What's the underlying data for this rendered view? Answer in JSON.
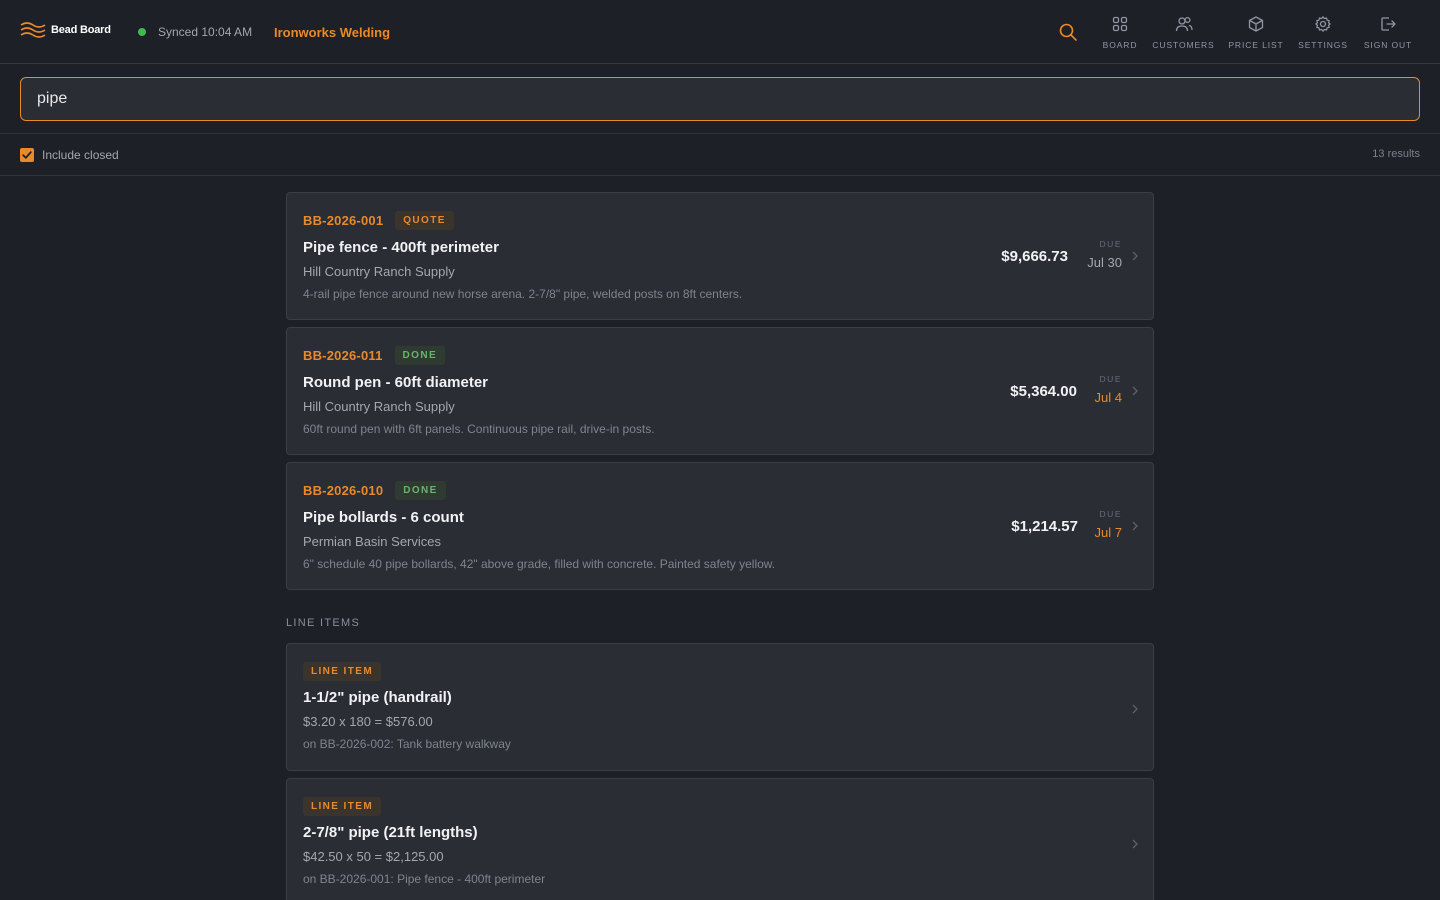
{
  "header": {
    "brand": "Bead Board",
    "sync_status": "Synced 10:04 AM",
    "company": "Ironworks Welding",
    "nav": [
      {
        "label": "BOARD",
        "icon": "grid-icon"
      },
      {
        "label": "CUSTOMERS",
        "icon": "users-icon"
      },
      {
        "label": "PRICE LIST",
        "icon": "box-icon"
      },
      {
        "label": "SETTINGS",
        "icon": "gear-icon"
      },
      {
        "label": "SIGN OUT",
        "icon": "sign-out-icon"
      }
    ],
    "accent_color": "#e8892b",
    "sync_color": "#3fb950"
  },
  "search": {
    "value": "pipe"
  },
  "filters": {
    "include_closed_label": "Include closed",
    "include_closed_checked": true,
    "result_count": "13 results"
  },
  "jobs": [
    {
      "id": "BB-2026-001",
      "status": "QUOTE",
      "title": "Pipe fence - 400ft perimeter",
      "customer": "Hill Country Ranch Supply",
      "description": "4-rail pipe fence around new horse arena. 2-7/8\" pipe, welded posts on 8ft centers.",
      "amount": "$9,666.73",
      "due_label": "DUE",
      "due_date": "Jul 30",
      "due_overdue": false
    },
    {
      "id": "BB-2026-011",
      "status": "DONE",
      "title": "Round pen - 60ft diameter",
      "customer": "Hill Country Ranch Supply",
      "description": "60ft round pen with 6ft panels. Continuous pipe rail, drive-in posts.",
      "amount": "$5,364.00",
      "due_label": "DUE",
      "due_date": "Jul 4",
      "due_overdue": true
    },
    {
      "id": "BB-2026-010",
      "status": "DONE",
      "title": "Pipe bollards - 6 count",
      "customer": "Permian Basin Services",
      "description": "6\" schedule 40 pipe bollards, 42\" above grade, filled with concrete. Painted safety yellow.",
      "amount": "$1,214.57",
      "due_label": "DUE",
      "due_date": "Jul 7",
      "due_overdue": true
    }
  ],
  "line_items_section": {
    "label": "LINE ITEMS",
    "items": [
      {
        "badge": "LINE ITEM",
        "title": "1-1/2\" pipe (handrail)",
        "calc": "$3.20 x 180 = $576.00",
        "ref": "on BB-2026-002: Tank battery walkway"
      },
      {
        "badge": "LINE ITEM",
        "title": "2-7/8\" pipe (21ft lengths)",
        "calc": "$42.50 x 50 = $2,125.00",
        "ref": "on BB-2026-001: Pipe fence - 400ft perimeter"
      }
    ]
  }
}
